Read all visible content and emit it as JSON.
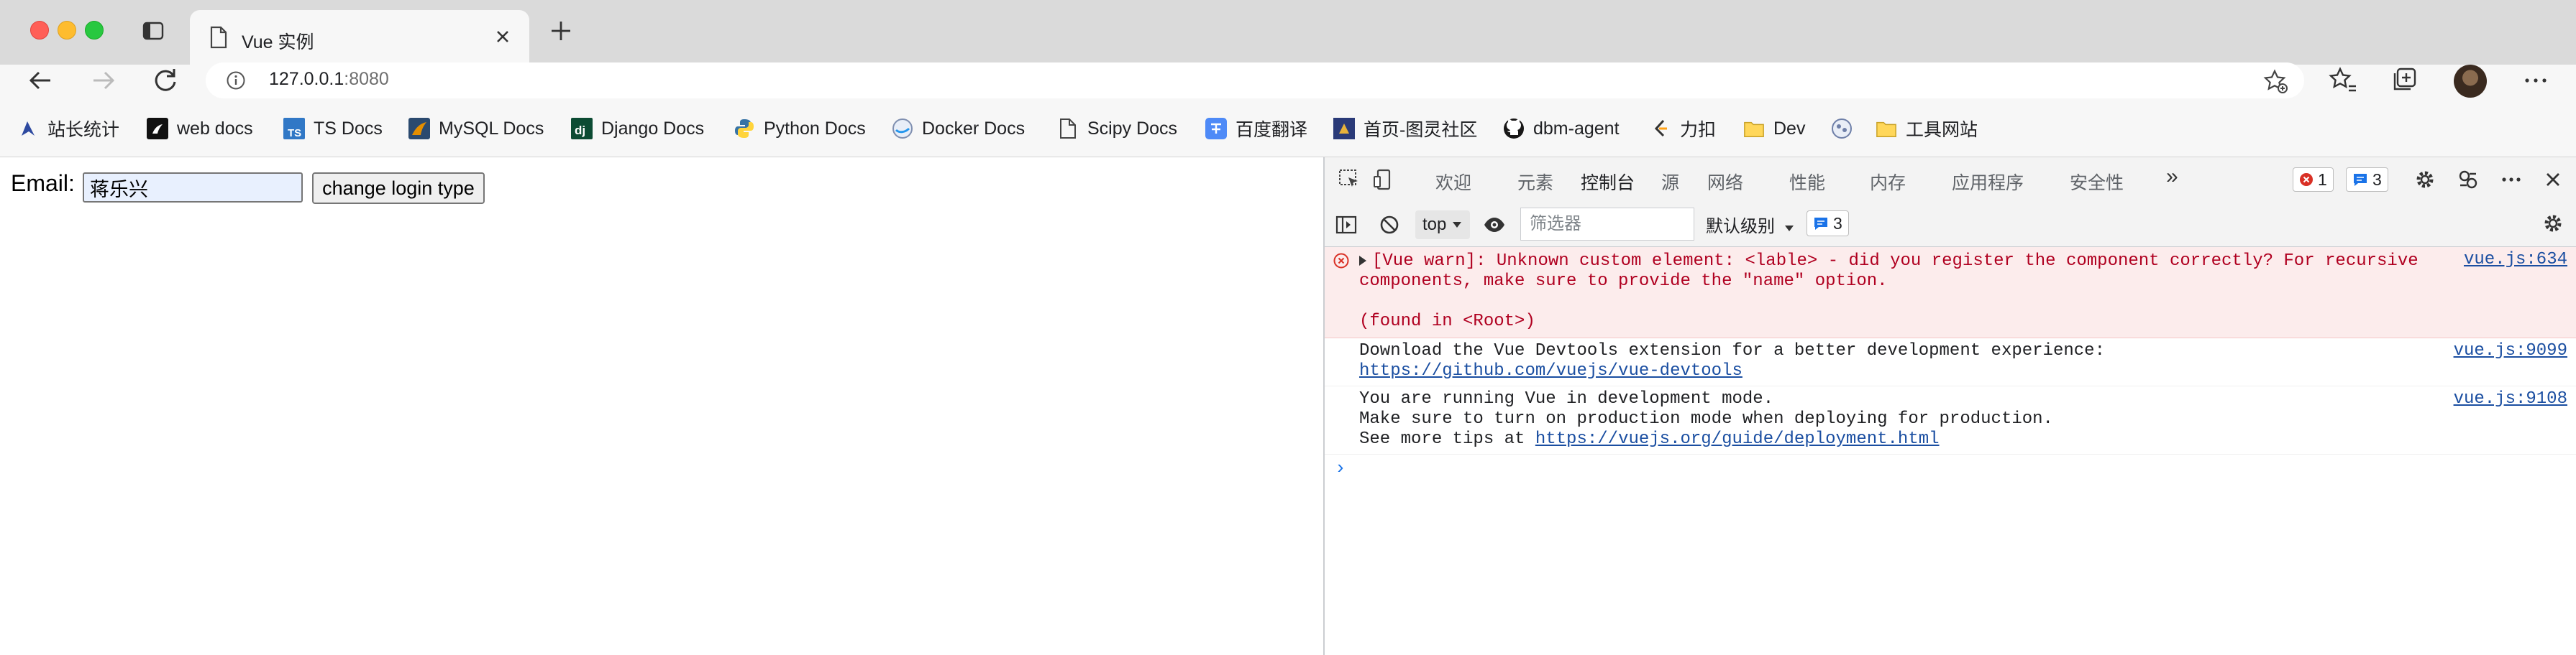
{
  "browser": {
    "tab_title": "Vue 实例",
    "url_host": "127.0.0.1",
    "url_port": ":8080",
    "bookmarks": [
      {
        "label": "站长统计",
        "icon": "analytics-icon"
      },
      {
        "label": "web docs",
        "icon": "mdn-icon"
      },
      {
        "label": "TS Docs",
        "icon": "ts-icon"
      },
      {
        "label": "MySQL Docs",
        "icon": "mysql-icon"
      },
      {
        "label": "Django Docs",
        "icon": "django-icon"
      },
      {
        "label": "Python Docs",
        "icon": "python-icon"
      },
      {
        "label": "Docker Docs",
        "icon": "docker-icon"
      },
      {
        "label": "Scipy Docs",
        "icon": "page-icon"
      },
      {
        "label": "百度翻译",
        "icon": "translate-icon"
      },
      {
        "label": "首页-图灵社区",
        "icon": "turing-icon"
      },
      {
        "label": "dbm-agent",
        "icon": "github-icon"
      },
      {
        "label": "力扣",
        "icon": "leetcode-icon"
      },
      {
        "label": "Dev",
        "icon": "folder-icon"
      },
      {
        "label": "",
        "icon": "bookmark-favicon"
      },
      {
        "label": "工具网站",
        "icon": "folder-icon"
      }
    ]
  },
  "page": {
    "email_label": "Email:",
    "email_value": "蒋乐兴",
    "login_button": "change login type"
  },
  "devtools": {
    "tabs": [
      "欢迎",
      "元素",
      "控制台",
      "源",
      "网络",
      "性能",
      "内存",
      "应用程序",
      "安全性"
    ],
    "active_tab": "控制台",
    "more_tabs": "»",
    "error_count": "1",
    "message_count": "3",
    "context": "top",
    "filter_placeholder": "筛选器",
    "levels": "默认级别",
    "issues_count": "3",
    "messages": [
      {
        "type": "error",
        "line1": "[Vue warn]: Unknown custom element: <lable> - did you register the component correctly? For recursive",
        "line2": "components, make sure to provide the \"name\" option.",
        "line3": "(found in <Root>)",
        "source": "vue.js:634"
      },
      {
        "type": "log",
        "line1": "Download the Vue Devtools extension for a better development experience:",
        "link": "https://github.com/vuejs/vue-devtools",
        "source": "vue.js:9099"
      },
      {
        "type": "log",
        "line1": "You are running Vue in development mode.",
        "line2": "Make sure to turn on production mode when deploying for production.",
        "line3_prefix": "See more tips at ",
        "link": "https://vuejs.org/guide/deployment.html",
        "source": "vue.js:9108"
      }
    ],
    "prompt": "›"
  },
  "colors": {
    "accent": "#1a73e8",
    "error_bg": "#fcecec",
    "error_text": "#b00020",
    "link": "#1a4ea1",
    "autofill_bg": "#e8f0fe"
  }
}
